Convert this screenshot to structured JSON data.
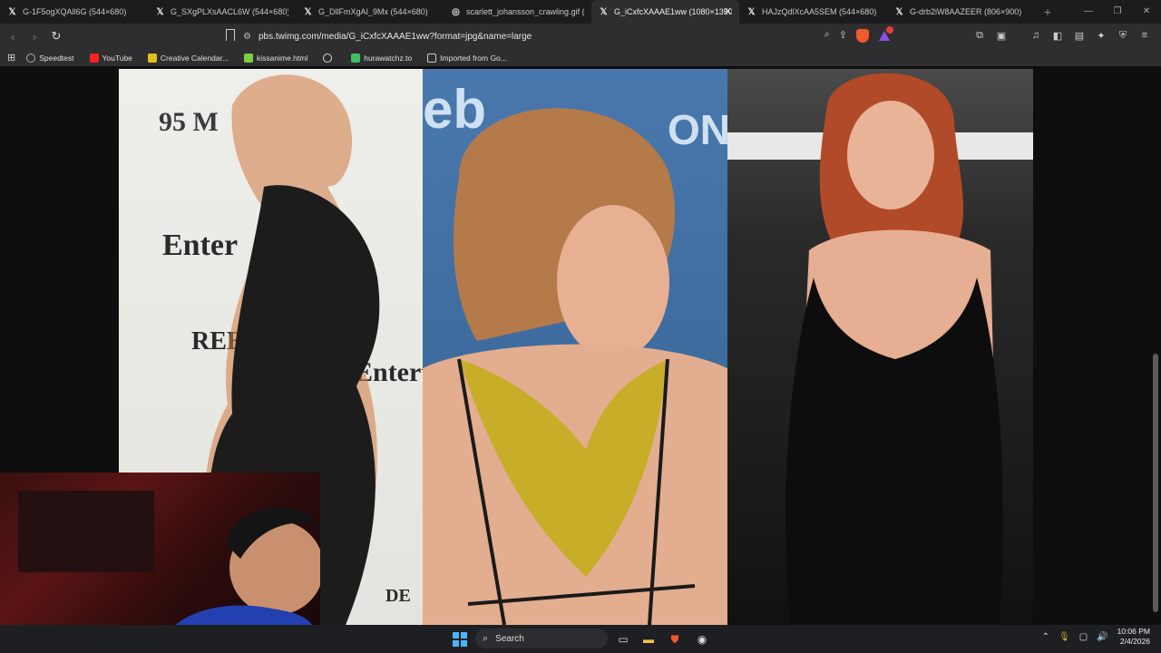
{
  "tabs": [
    {
      "title": "G-1F5ogXQAll6G (544×680)",
      "icon": "x-icon"
    },
    {
      "title": "G_SXgPLXsAACL6W (544×680)",
      "icon": "x-icon"
    },
    {
      "title": "G_DllFmXgAI_9Mx (544×680)",
      "icon": "x-icon"
    },
    {
      "title": "scarlett_johansson_crawling.gif (423",
      "icon": "globe-icon"
    },
    {
      "title": "G_iCxfcXAAAE1ww (1080×1350)",
      "icon": "x-icon",
      "active": true
    },
    {
      "title": "HAJzQdlXcAA5SEM (544×680)",
      "icon": "x-icon"
    },
    {
      "title": "G-drb2iW8AAZEER (806×900)",
      "icon": "x-icon"
    }
  ],
  "address": {
    "url": "pbs.twimg.com/media/G_iCxfcXAAAE1ww?format=jpg&name=large"
  },
  "bookmarks": [
    {
      "label": "Speedtest",
      "color": "#aaaaaa"
    },
    {
      "label": "YouTube",
      "color": "#ff2020"
    },
    {
      "label": "Creative Calendar...",
      "color": "#e0c020"
    },
    {
      "label": "kissanime.html",
      "color": "#7ad040"
    },
    {
      "label": "",
      "color": "#dddddd"
    },
    {
      "label": "hurawatchz.to",
      "color": "#3fc060"
    },
    {
      "label": "Imported from Go...",
      "color": "#cccccc"
    }
  ],
  "overlay_text": {
    "p1_a": "95 M",
    "p1_b": "Enter",
    "p1_c": "REE",
    "p1_d": "Entert",
    "p1_e": "DE",
    "p2_a": "eb",
    "p2_b": "ON"
  },
  "taskbar": {
    "search_placeholder": "Search",
    "time": "10:06 PM",
    "date": "2/4/2026"
  }
}
